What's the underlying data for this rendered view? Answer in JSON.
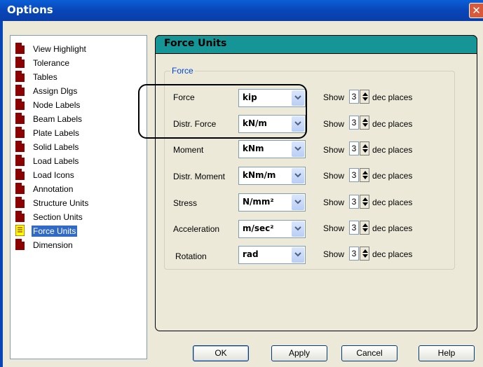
{
  "window": {
    "title": "Options",
    "close_glyph": "✕"
  },
  "tree": {
    "selected_index": 13,
    "items": [
      {
        "label": "View Highlight",
        "icon": "document-icon"
      },
      {
        "label": "Tolerance",
        "icon": "document-icon"
      },
      {
        "label": "Tables",
        "icon": "document-icon"
      },
      {
        "label": "Assign Dlgs",
        "icon": "document-icon"
      },
      {
        "label": "Node Labels",
        "icon": "document-icon"
      },
      {
        "label": "Beam Labels",
        "icon": "document-icon"
      },
      {
        "label": "Plate Labels",
        "icon": "document-icon"
      },
      {
        "label": "Solid Labels",
        "icon": "document-icon"
      },
      {
        "label": "Load Labels",
        "icon": "document-icon"
      },
      {
        "label": "Load Icons",
        "icon": "document-icon"
      },
      {
        "label": "Annotation",
        "icon": "document-icon"
      },
      {
        "label": "Structure Units",
        "icon": "document-icon"
      },
      {
        "label": "Section Units",
        "icon": "document-icon"
      },
      {
        "label": "Force Units",
        "icon": "open-document-icon"
      },
      {
        "label": "Dimension",
        "icon": "document-icon"
      }
    ]
  },
  "panel": {
    "title": "Force Units",
    "group_label": "Force",
    "show_label": "Show",
    "dec_label": "dec places",
    "rows": [
      {
        "label": "Force",
        "unit": "kip",
        "decimals": "3"
      },
      {
        "label": "Distr. Force",
        "unit": "kN/m",
        "decimals": "3"
      },
      {
        "label": "Moment",
        "unit": "kNm",
        "decimals": "3"
      },
      {
        "label": "Distr. Moment",
        "unit": "kNm/m",
        "decimals": "3"
      },
      {
        "label": "Stress",
        "unit": "N/mm²",
        "decimals": "3"
      },
      {
        "label": "Acceleration",
        "unit": "m/sec²",
        "decimals": "3"
      },
      {
        "label": "Rotation",
        "unit": "rad",
        "decimals": "3"
      }
    ]
  },
  "buttons": {
    "ok": "OK",
    "apply": "Apply",
    "cancel": "Cancel",
    "help": "Help"
  },
  "colors": {
    "title_bar": "#0846b8",
    "panel_header": "#159596",
    "selection": "#316ac5",
    "group_label": "#0046d5"
  }
}
